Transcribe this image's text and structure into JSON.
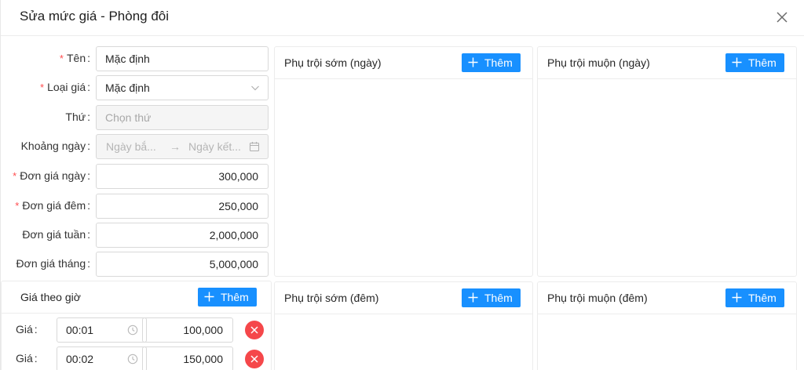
{
  "modal": {
    "title": "Sửa mức giá - Phòng đôi",
    "close_label": "Đóng"
  },
  "form": {
    "name": {
      "label": "Tên",
      "required": true,
      "value": "Mặc định"
    },
    "price_type": {
      "label": "Loại giá",
      "required": true,
      "value": "Mặc định"
    },
    "weekday": {
      "label": "Thứ",
      "required": false,
      "placeholder": "Chọn thứ"
    },
    "date_range": {
      "label": "Khoảng ngày",
      "required": false,
      "start_placeholder": "Ngày bắ...",
      "arrow": "→",
      "end_placeholder": "Ngày kết..."
    },
    "day_price": {
      "label": "Đơn giá ngày",
      "required": true,
      "value": "300,000"
    },
    "night_price": {
      "label": "Đơn giá đêm",
      "required": true,
      "value": "250,000"
    },
    "week_price": {
      "label": "Đơn giá tuần",
      "required": false,
      "value": "2,000,000"
    },
    "month_price": {
      "label": "Đơn giá tháng",
      "required": false,
      "value": "5,000,000"
    },
    "colon": ":",
    "required_mark": "*"
  },
  "hourly": {
    "title": "Giá theo giờ",
    "add_label": "Thêm",
    "row_label": "Giá",
    "rows": [
      {
        "time": "00:01",
        "price": "100,000"
      },
      {
        "time": "00:02",
        "price": "150,000"
      }
    ]
  },
  "panels": {
    "early_day": {
      "title": "Phụ trội sớm (ngày)",
      "add_label": "Thêm"
    },
    "late_day": {
      "title": "Phụ trội muộn (ngày)",
      "add_label": "Thêm"
    },
    "early_night": {
      "title": "Phụ trội sớm (đêm)",
      "add_label": "Thêm"
    },
    "late_night": {
      "title": "Phụ trội muộn (đêm)",
      "add_label": "Thêm"
    }
  },
  "colors": {
    "primary": "#1890ff",
    "danger": "#f5474a",
    "required": "#ff4d4f",
    "border": "#d9d9d9"
  },
  "icons": {
    "close": "close-icon",
    "select": "chevron-down-icon",
    "calendar": "calendar-icon",
    "clock": "clock-icon",
    "add": "plus-icon",
    "delete": "delete-circle-icon"
  }
}
